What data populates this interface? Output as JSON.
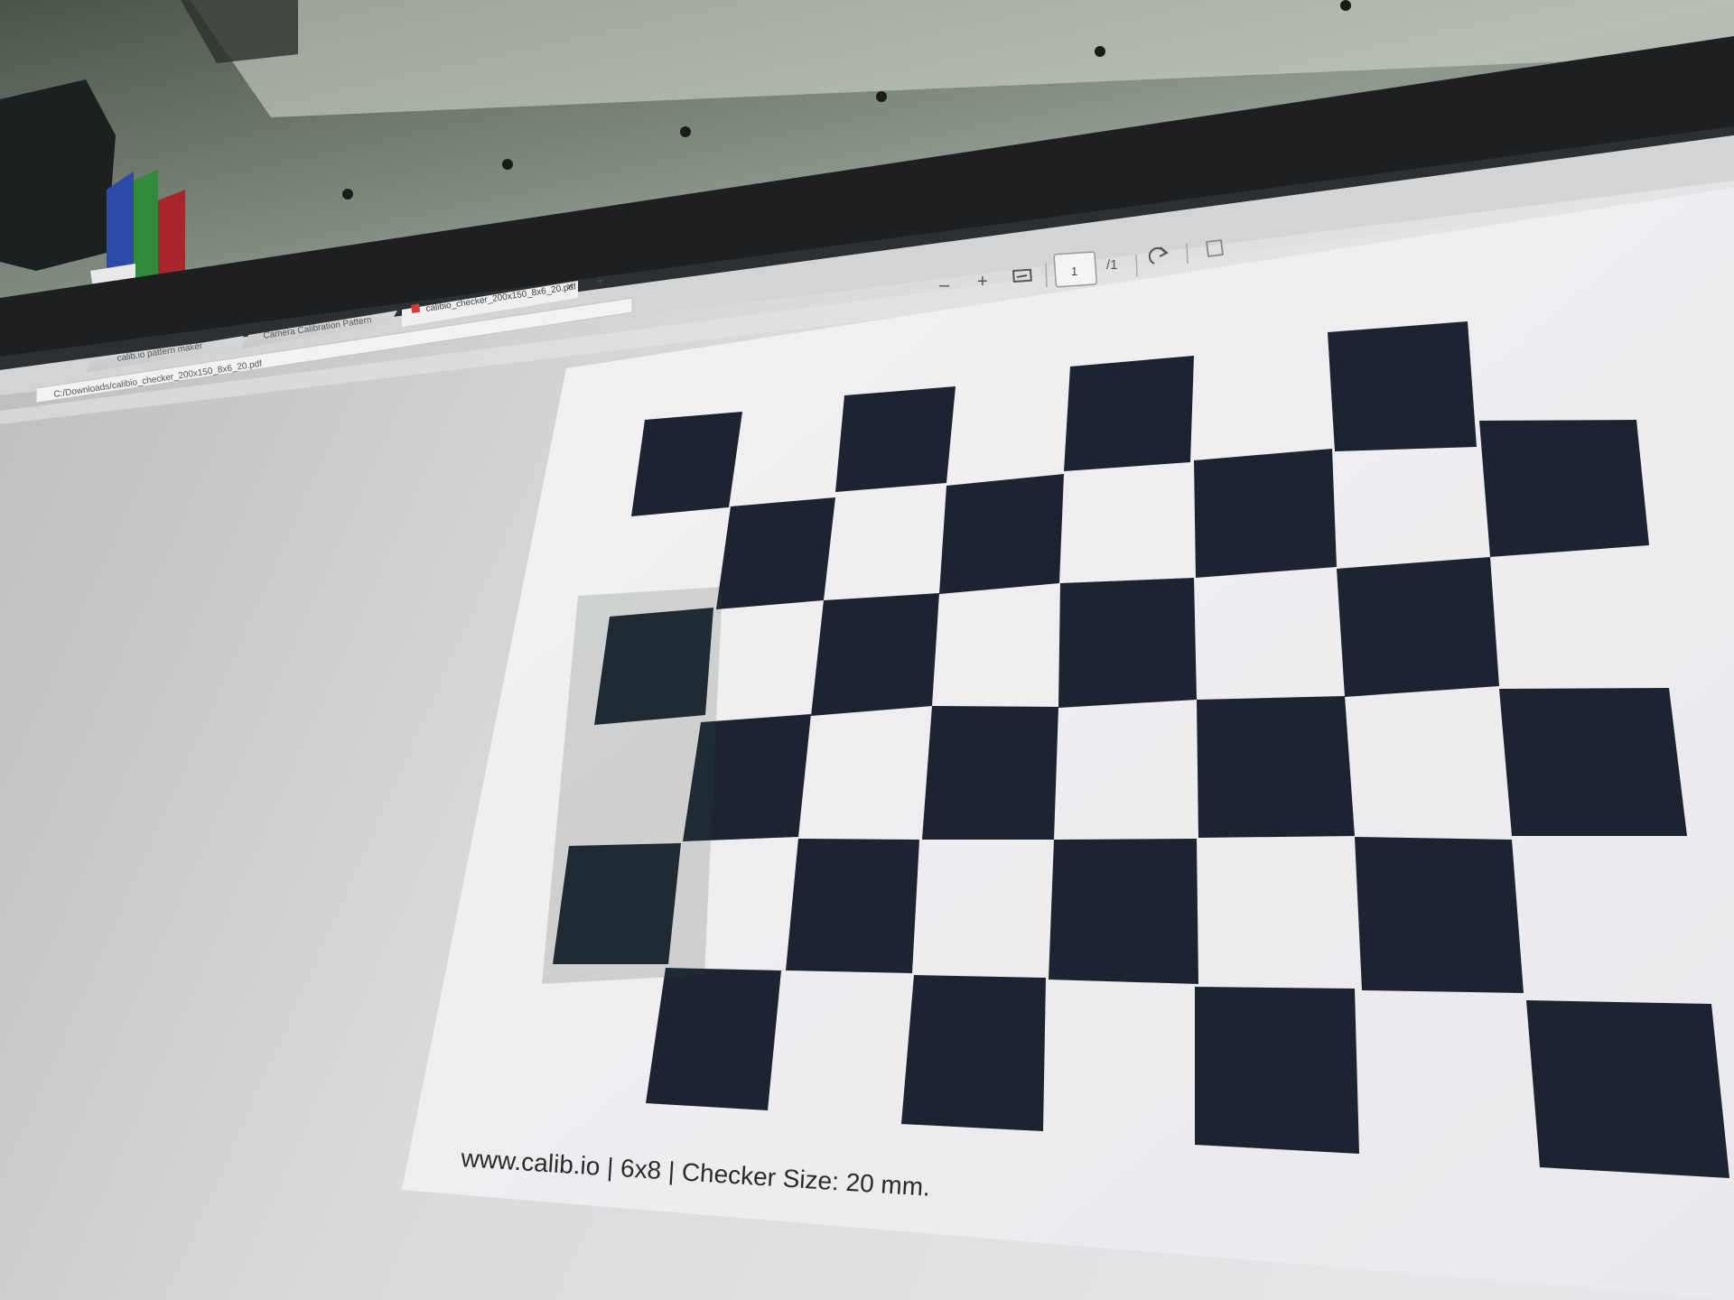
{
  "browser": {
    "tabs": [
      {
        "label": "calib.io pattern maker"
      },
      {
        "label": "Camera Calibration Pattern"
      },
      {
        "label": "calibio_checker_200x150_8x6_20.pdf"
      }
    ],
    "new_tab_label": "+",
    "close_tab_label": "×",
    "address": "C:/Downloads/calibio_checker_200x150_8x6_20.pdf"
  },
  "pdf_toolbar": {
    "zoom_out_label": "–",
    "zoom_in_label": "+",
    "fit_icon": "fit-page-icon",
    "page_current": "1",
    "page_total": "/1",
    "rotate_icon": "rotate-icon",
    "bookmark_icon": "bookmark-icon"
  },
  "document": {
    "caption": "www.calib.io | 6x8 | Checker Size: 20 mm."
  },
  "colors": {
    "checker_dark": "#1b2430",
    "page": "#ececef",
    "bezel": "#1d1f21",
    "wall": "#9aa69a"
  }
}
